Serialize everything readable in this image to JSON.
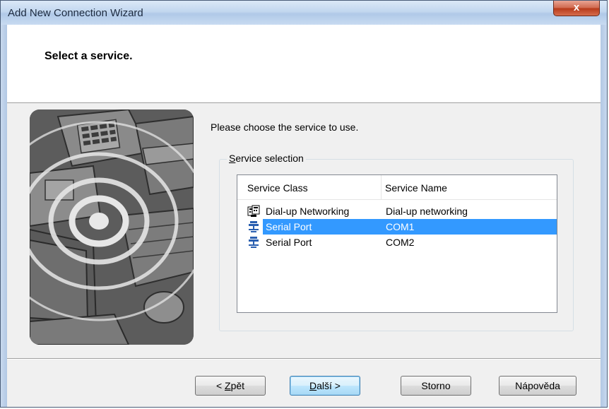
{
  "window": {
    "title": "Add New Connection Wizard",
    "close_glyph": "x"
  },
  "header": {
    "title": "Select a service."
  },
  "main": {
    "instruction": "Please choose the service to use.",
    "group": {
      "label_accel": "S",
      "label_rest": "ervice selection"
    },
    "list": {
      "columns": [
        "Service Class",
        "Service Name"
      ],
      "rows": [
        {
          "class": "Dial-up Networking",
          "name": "Dial-up networking",
          "icon": "dialup-networking-icon",
          "selected": false
        },
        {
          "class": "Serial Port",
          "name": "COM1",
          "icon": "serial-port-icon",
          "selected": true
        },
        {
          "class": "Serial Port",
          "name": "COM2",
          "icon": "serial-port-icon",
          "selected": false
        }
      ]
    }
  },
  "buttons": {
    "back": {
      "pre": "< ",
      "accel": "Z",
      "rest": "pět"
    },
    "next": {
      "accel": "D",
      "rest": "alší >"
    },
    "cancel": "Storno",
    "help": "Nápověda"
  },
  "colors": {
    "selection": "#3399ff",
    "title_gradient_top": "#dbe8f7",
    "close_red": "#c44a2a"
  }
}
